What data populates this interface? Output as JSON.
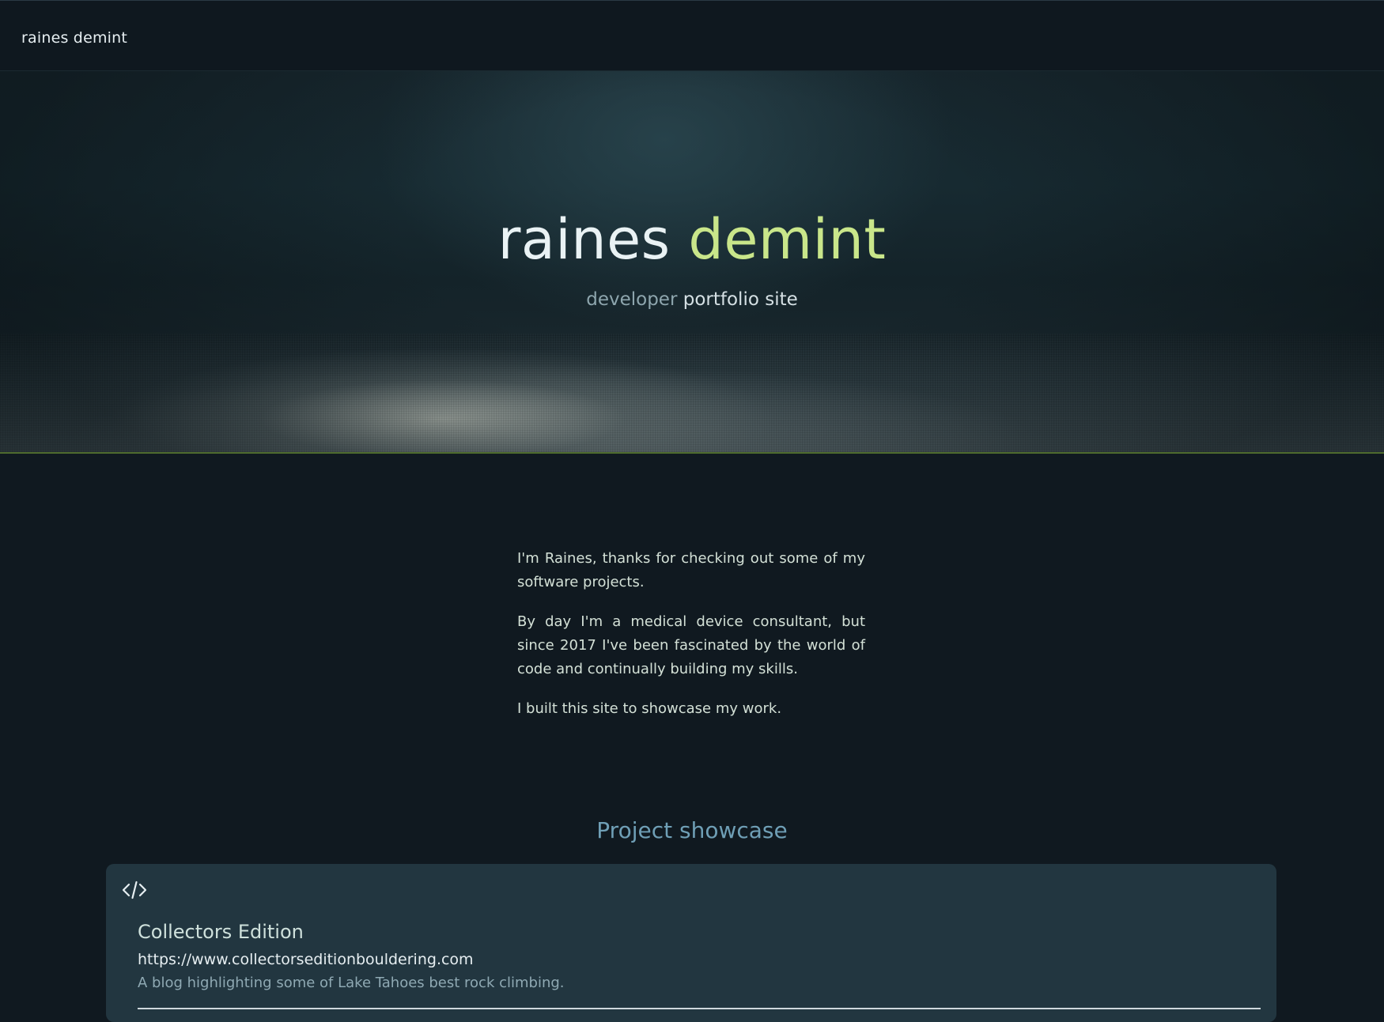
{
  "nav": {
    "brand": "raines demint"
  },
  "hero": {
    "title_first": "raines",
    "title_second": "demint",
    "subtitle_first": "developer",
    "subtitle_second": "portfolio site"
  },
  "about": {
    "paragraphs": [
      "I'm Raines, thanks for checking out some of my software projects.",
      "By day I'm a medical device consultant, but since 2017 I've been fascinated by the world of code and continually building my skills.",
      "I built this site to showcase my work."
    ]
  },
  "projects": {
    "section_title": "Project showcase",
    "items": [
      {
        "icon": "code-icon",
        "name": "Collectors Edition",
        "url": "https://www.collectorseditionbouldering.com",
        "description": "A blog highlighting some of Lake Tahoes best rock climbing."
      }
    ]
  },
  "colors": {
    "background": "#101920",
    "accent_green": "#c9e68a",
    "section_title": "#6f9fb6",
    "card_background": "#223640"
  }
}
